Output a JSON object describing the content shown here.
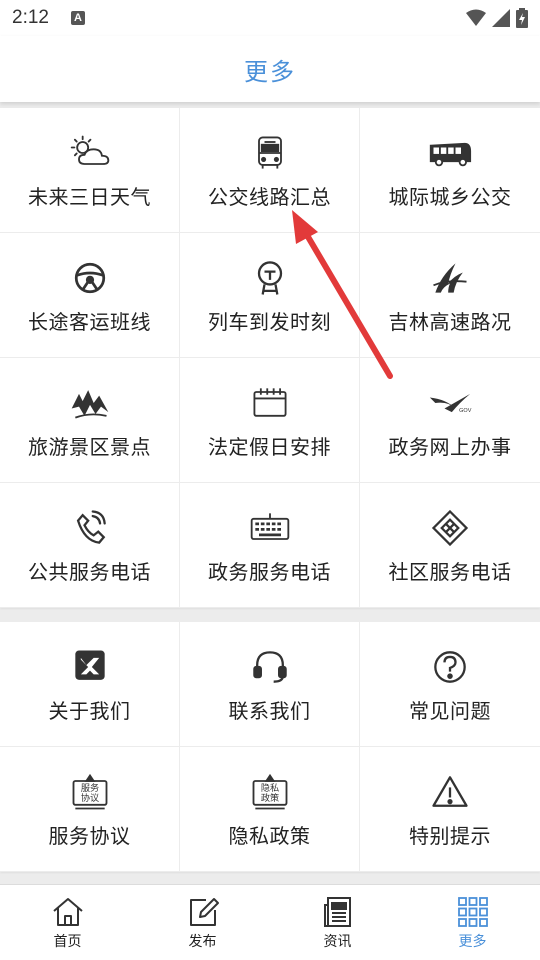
{
  "status": {
    "time": "2:12",
    "notification_letter": "A"
  },
  "header": {
    "title": "更多"
  },
  "services": [
    {
      "label": "未来三日天气",
      "icon": "weather-icon"
    },
    {
      "label": "公交线路汇总",
      "icon": "bus-icon"
    },
    {
      "label": "城际城乡公交",
      "icon": "coach-icon"
    },
    {
      "label": "长途客运班线",
      "icon": "steering-wheel-icon"
    },
    {
      "label": "列车到发时刻",
      "icon": "railway-icon"
    },
    {
      "label": "吉林高速路况",
      "icon": "highway-logo-icon"
    },
    {
      "label": "旅游景区景点",
      "icon": "scenery-icon"
    },
    {
      "label": "法定假日安排",
      "icon": "calendar-icon"
    },
    {
      "label": "政务网上办事",
      "icon": "gov-swoosh-icon"
    },
    {
      "label": "公共服务电话",
      "icon": "phone-icon"
    },
    {
      "label": "政务服务电话",
      "icon": "keyboard-icon"
    },
    {
      "label": "社区服务电话",
      "icon": "community-icon"
    }
  ],
  "info": [
    {
      "label": "关于我们",
      "icon": "about-logo-icon"
    },
    {
      "label": "联系我们",
      "icon": "headset-icon"
    },
    {
      "label": "常见问题",
      "icon": "question-icon"
    },
    {
      "label": "服务协议",
      "icon": "agreement-sign-icon",
      "sign_text": "服务协议"
    },
    {
      "label": "隐私政策",
      "icon": "privacy-sign-icon",
      "sign_text": "隐私政策"
    },
    {
      "label": "特别提示",
      "icon": "warning-icon"
    }
  ],
  "bottom_nav": [
    {
      "label": "首页",
      "icon": "home-icon",
      "active": false
    },
    {
      "label": "发布",
      "icon": "edit-icon",
      "active": false
    },
    {
      "label": "资讯",
      "icon": "news-icon",
      "active": false
    },
    {
      "label": "更多",
      "icon": "grid-icon",
      "active": true
    }
  ],
  "colors": {
    "accent": "#4a90d9",
    "annotation_arrow": "#e23a3a",
    "icon": "#333333"
  }
}
